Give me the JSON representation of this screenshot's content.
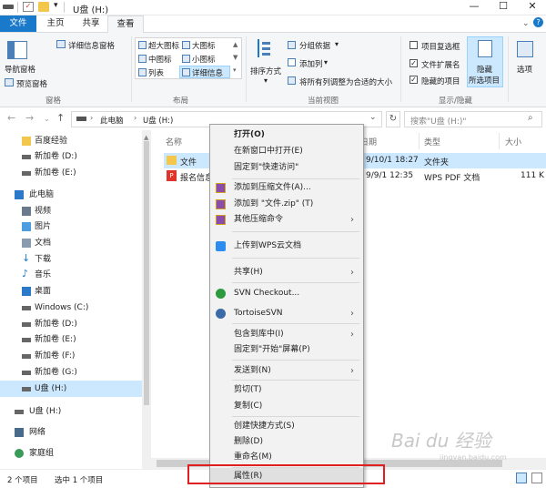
{
  "window": {
    "title": "U盘 (H:)",
    "minimize": "—",
    "maximize": "☐",
    "close": "✕"
  },
  "tabs": {
    "file": "文件",
    "home": "主页",
    "share": "共享",
    "view": "查看"
  },
  "ribbon": {
    "pane": {
      "nav_pane": "导航窗格",
      "preview_pane": "预览窗格",
      "details_pane": "详细信息窗格",
      "group": "窗格"
    },
    "layout": {
      "extra_large": "超大图标",
      "large": "大图标",
      "medium": "中图标",
      "small": "小图标",
      "list": "列表",
      "details": "详细信息",
      "group": "布局"
    },
    "current_view": {
      "sort": "排序方式",
      "group_by": "分组依据",
      "add_columns": "添加列",
      "size_columns": "将所有列调整为合适的大小",
      "group": "当前视图"
    },
    "show_hide": {
      "item_checkboxes": "项目复选框",
      "file_extensions": "文件扩展名",
      "hidden_items": "隐藏的项目",
      "hide_selected": "隐藏",
      "hide_selected2": "所选项目",
      "options": "选项",
      "group": "显示/隐藏"
    }
  },
  "address": {
    "root": "此电脑",
    "current": "U盘 (H:)",
    "search_placeholder": "搜索\"U盘 (H:)\""
  },
  "nav": {
    "baidu": "百度经验",
    "d": "新加卷 (D:)",
    "e": "新加卷 (E:)",
    "this_pc": "此电脑",
    "videos": "视频",
    "pictures": "图片",
    "documents": "文档",
    "downloads": "下载",
    "music": "音乐",
    "desktop": "桌面",
    "c": "Windows (C:)",
    "d2": "新加卷 (D:)",
    "e2": "新加卷 (E:)",
    "f": "新加卷 (F:)",
    "g": "新加卷 (G:)",
    "h": "U盘 (H:)",
    "h2": "U盘 (H:)",
    "network": "网络",
    "homegroup": "家庭组"
  },
  "columns": {
    "name": "名称",
    "date": "日期",
    "type": "类型",
    "size": "大小"
  },
  "files": [
    {
      "name": "文件",
      "date": "9/10/1 18:27",
      "type": "文件夹",
      "size": ""
    },
    {
      "name": "报名信息",
      "date": "9/9/1 12:35",
      "type": "WPS PDF 文档",
      "size": "111 K"
    }
  ],
  "status": {
    "count": "2 个项目",
    "selected": "选中 1 个项目"
  },
  "menu": {
    "open": "打开(O)",
    "open_new": "在新窗口中打开(E)",
    "pin_quick": "固定到\"快速访问\"",
    "add_archive": "添加到压缩文件(A)...",
    "add_zip": "添加到 \"文件.zip\" (T)",
    "other_compress": "其他压缩命令",
    "upload_wps": "上传到WPS云文档",
    "share": "共享(H)",
    "svn_checkout": "SVN Checkout...",
    "tortoise": "TortoiseSVN",
    "include_lib": "包含到库中(I)",
    "pin_start": "固定到\"开始\"屏幕(P)",
    "send_to": "发送到(N)",
    "cut": "剪切(T)",
    "copy": "复制(C)",
    "create_shortcut": "创建快捷方式(S)",
    "delete": "删除(D)",
    "rename": "重命名(M)",
    "properties": "属性(R)"
  },
  "watermark": {
    "text": "Bai du 经验",
    "url": "jingyan.baidu.com"
  }
}
